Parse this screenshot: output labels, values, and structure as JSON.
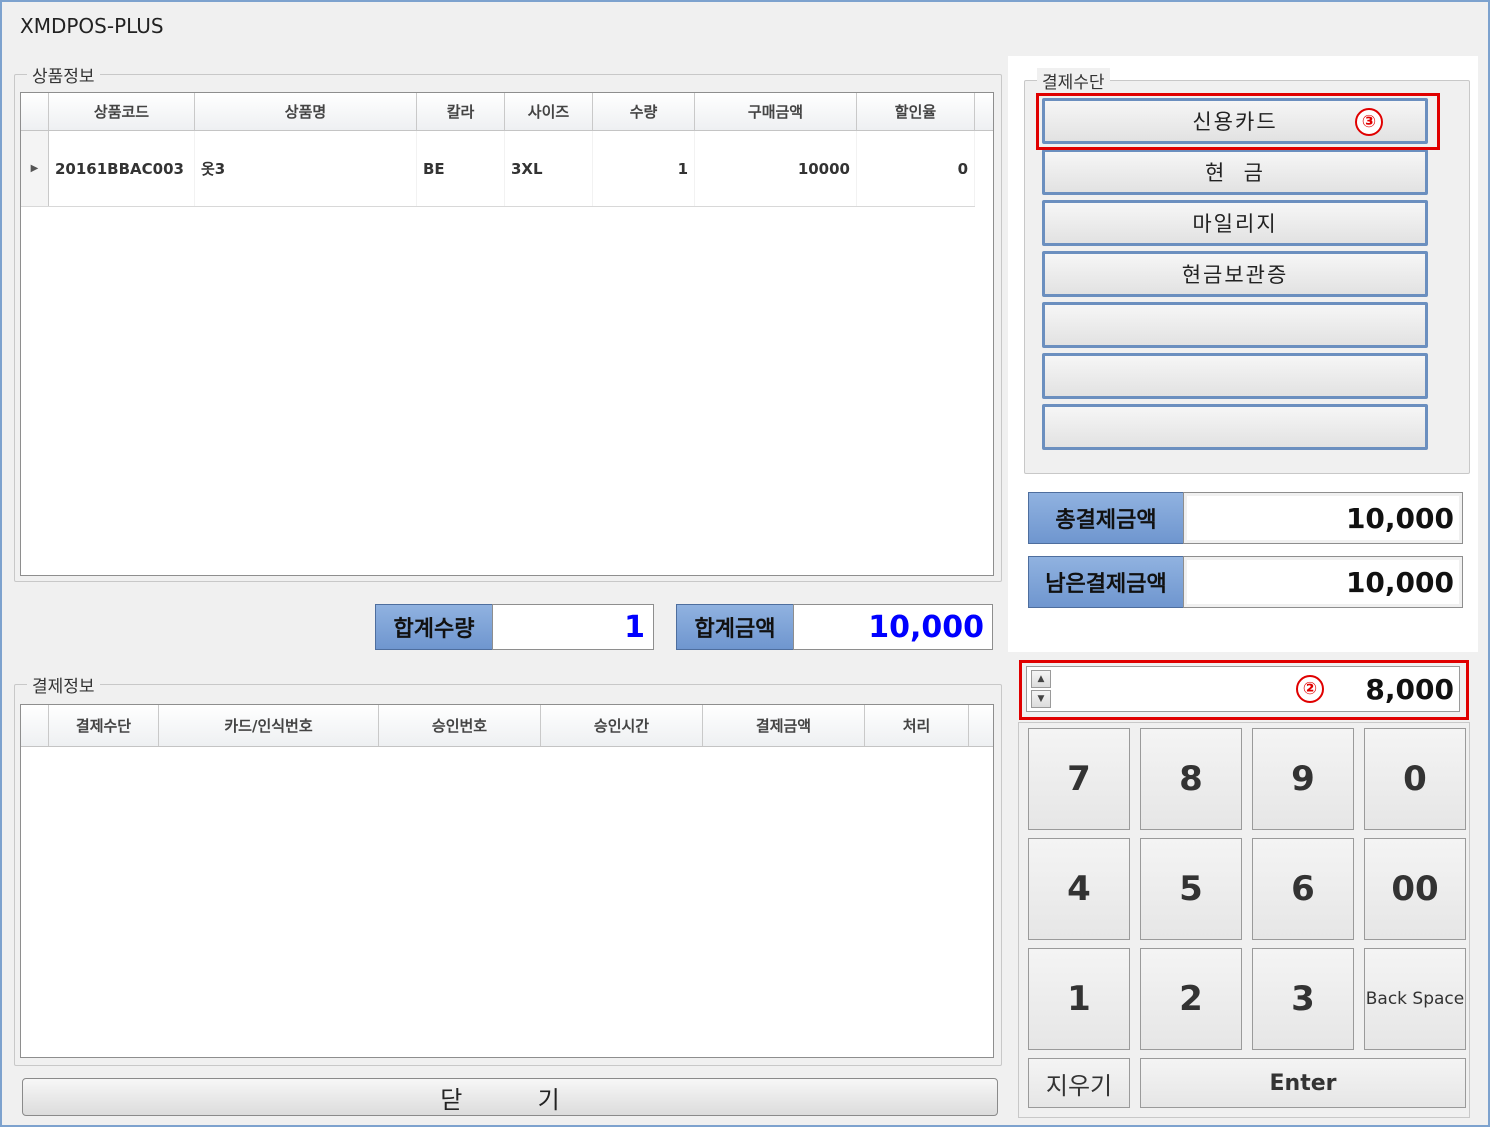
{
  "window": {
    "title": "XMDPOS-PLUS"
  },
  "product_section": {
    "label": "상품정보",
    "columns": [
      "상품코드",
      "상품명",
      "칼라",
      "사이즈",
      "수량",
      "구매금액",
      "할인율"
    ],
    "rows": [
      {
        "code": "20161BBAC003",
        "name": "옷3",
        "color": "BE",
        "size": "3XL",
        "qty": "1",
        "amount": "10000",
        "discount": "0"
      }
    ]
  },
  "totals": {
    "qty_label": "합계수량",
    "qty_value": "1",
    "amount_label": "합계금액",
    "amount_value": "10,000"
  },
  "payment_info_section": {
    "label": "결제정보",
    "columns": [
      "결제수단",
      "카드/인식번호",
      "승인번호",
      "승인시간",
      "결제금액",
      "처리"
    ]
  },
  "close_button": "닫  기",
  "payment_methods": {
    "label": "결제수단",
    "buttons": [
      "신용카드",
      "현  금",
      "마일리지",
      "현금보관증",
      "",
      "",
      ""
    ],
    "marker": "③"
  },
  "summary": {
    "total_label": "총결제금액",
    "total_value": "10,000",
    "remaining_label": "남은결제금액",
    "remaining_value": "10,000"
  },
  "amount_input": {
    "value": "8,000",
    "marker": "②"
  },
  "keypad": {
    "keys": [
      "7",
      "8",
      "9",
      "0",
      "4",
      "5",
      "6",
      "00",
      "1",
      "2",
      "3",
      "Back Space"
    ],
    "clear": "지우기",
    "enter": "Enter"
  },
  "colors": {
    "accent_blue": "#0000ff",
    "header_blue": "#7aa0d6",
    "marker_red": "#e00000"
  }
}
